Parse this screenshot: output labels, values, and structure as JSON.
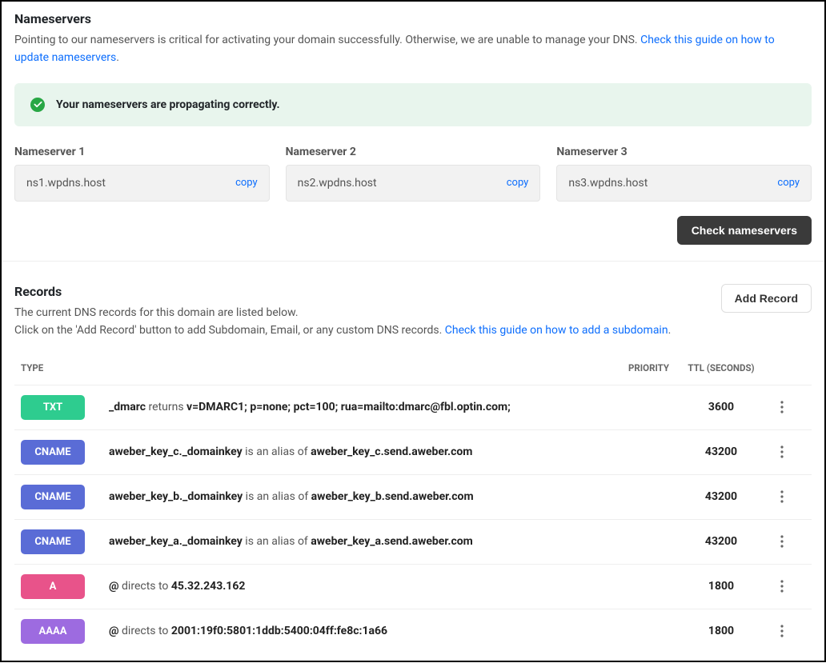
{
  "nameservers": {
    "title": "Nameservers",
    "desc_prefix": "Pointing to our nameservers is critical for activating your domain successfully. Otherwise, we are unable to manage your DNS. ",
    "desc_link": "Check this guide on how to update nameservers",
    "desc_suffix": ".",
    "alert": "Your nameservers are propagating correctly.",
    "items": [
      {
        "label": "Nameserver 1",
        "value": "ns1.wpdns.host",
        "copy": "copy"
      },
      {
        "label": "Nameserver 2",
        "value": "ns2.wpdns.host",
        "copy": "copy"
      },
      {
        "label": "Nameserver 3",
        "value": "ns3.wpdns.host",
        "copy": "copy"
      }
    ],
    "check_btn": "Check nameservers"
  },
  "records": {
    "title": "Records",
    "sub1": "The current DNS records for this domain are listed below.",
    "sub2_prefix": "Click on the 'Add Record' button to add Subdomain, Email, or any custom DNS records. ",
    "sub2_link": "Check this guide on how to add a subdomain",
    "sub2_suffix": ".",
    "add_btn": "Add Record",
    "headers": {
      "type": "TYPE",
      "priority": "PRIORITY",
      "ttl": "TTL (SECONDS)"
    },
    "rows": [
      {
        "badge": "TXT",
        "badge_class": "badge-txt",
        "host": "_dmarc",
        "verb": " returns ",
        "target": "v=DMARC1; p=none; pct=100; rua=mailto:dmarc@fbl.optin.com;",
        "priority": "",
        "ttl": "3600"
      },
      {
        "badge": "CNAME",
        "badge_class": "badge-cname",
        "host": "aweber_key_c._domainkey",
        "verb": " is an alias of ",
        "target": "aweber_key_c.send.aweber.com",
        "priority": "",
        "ttl": "43200"
      },
      {
        "badge": "CNAME",
        "badge_class": "badge-cname",
        "host": "aweber_key_b._domainkey",
        "verb": " is an alias of ",
        "target": "aweber_key_b.send.aweber.com",
        "priority": "",
        "ttl": "43200"
      },
      {
        "badge": "CNAME",
        "badge_class": "badge-cname",
        "host": "aweber_key_a._domainkey",
        "verb": " is an alias of ",
        "target": "aweber_key_a.send.aweber.com",
        "priority": "",
        "ttl": "43200"
      },
      {
        "badge": "A",
        "badge_class": "badge-a",
        "host": "@",
        "verb": " directs to ",
        "target": "45.32.243.162",
        "priority": "",
        "ttl": "1800"
      },
      {
        "badge": "AAAA",
        "badge_class": "badge-aaaa",
        "host": "@",
        "verb": " directs to ",
        "target": "2001:19f0:5801:1ddb:5400:04ff:fe8c:1a66",
        "priority": "",
        "ttl": "1800"
      }
    ]
  }
}
